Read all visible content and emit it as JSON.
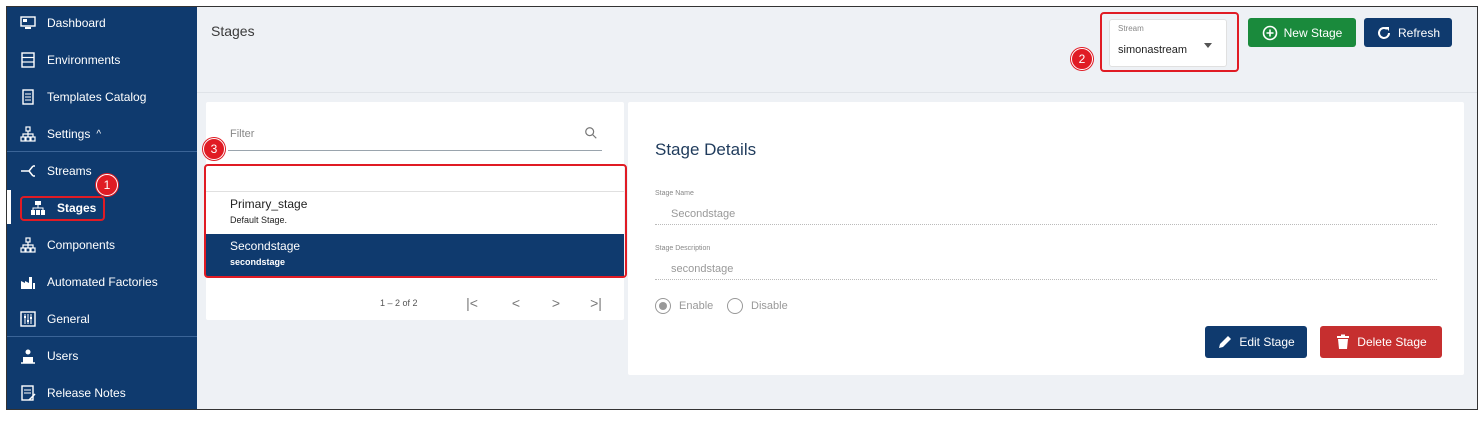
{
  "sidebar": {
    "items": [
      {
        "label": "Dashboard",
        "icon": "monitor-icon"
      },
      {
        "label": "Environments",
        "icon": "server-icon"
      },
      {
        "label": "Templates Catalog",
        "icon": "document-icon"
      },
      {
        "label": "Settings",
        "icon": "network-icon",
        "chevron": "^"
      },
      {
        "label": "Streams",
        "icon": "stream-icon"
      },
      {
        "label": "Stages",
        "icon": "stages-icon"
      },
      {
        "label": "Components",
        "icon": "network-icon"
      },
      {
        "label": "Automated Factories",
        "icon": "factory-icon"
      },
      {
        "label": "General",
        "icon": "sliders-icon"
      },
      {
        "label": "Users",
        "icon": "users-icon"
      },
      {
        "label": "Release Notes",
        "icon": "notes-icon"
      }
    ]
  },
  "header": {
    "title": "Stages",
    "stream_select": {
      "label": "Stream",
      "value": "simonastream"
    },
    "new_stage_label": "New Stage",
    "refresh_label": "Refresh"
  },
  "list": {
    "filter_placeholder": "Filter",
    "rows": [
      {
        "name": "Primary_stage",
        "description": "Default Stage."
      },
      {
        "name": "Secondstage",
        "description": "secondstage"
      }
    ],
    "pager_text": "1 – 2 of 2",
    "pager_buttons": {
      "first": "|<",
      "prev": "<",
      "next": ">",
      "last": ">|"
    }
  },
  "details": {
    "title": "Stage Details",
    "name_label": "Stage Name",
    "name_value": "Secondstage",
    "description_label": "Stage Description",
    "description_value": "secondstage",
    "enable_label": "Enable",
    "disable_label": "Disable",
    "edit_label": "Edit Stage",
    "delete_label": "Delete Stage"
  },
  "annotations": [
    "1",
    "2",
    "3"
  ],
  "colors": {
    "sidebar": "#0f3a6e",
    "accent_green": "#1a8a3c",
    "danger": "#c62f2f",
    "highlight": "#e01b24"
  }
}
